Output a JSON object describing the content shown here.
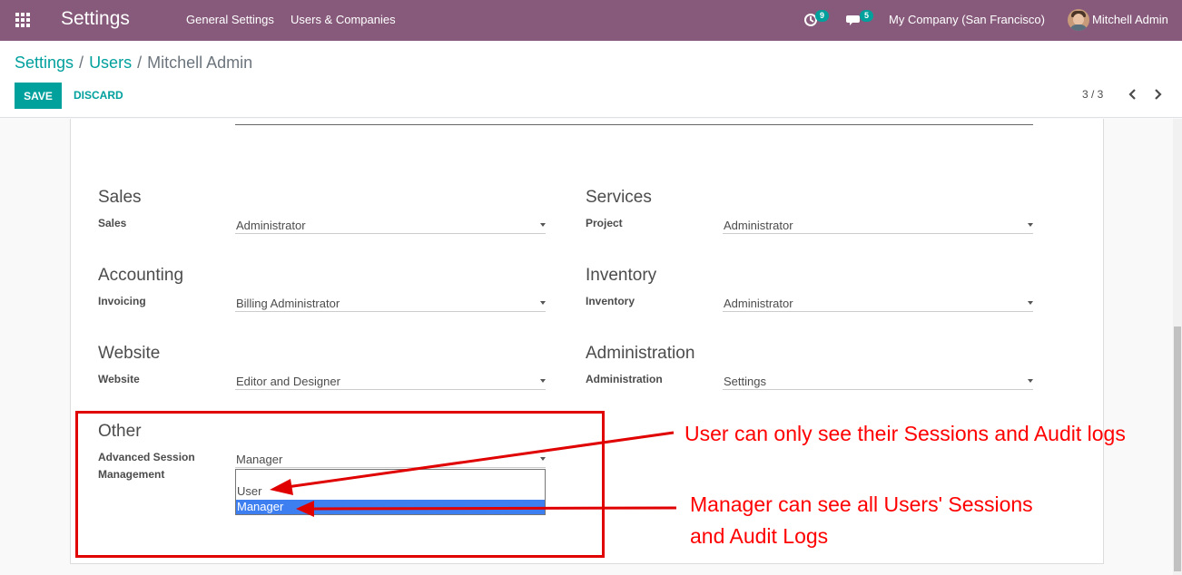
{
  "navbar": {
    "app_name": "Settings",
    "menu": [
      "General Settings",
      "Users & Companies"
    ],
    "activity_count": "9",
    "messages_count": "5",
    "company": "My Company (San Francisco)",
    "user": "Mitchell Admin"
  },
  "breadcrumb": [
    "Settings",
    "Users",
    "Mitchell Admin"
  ],
  "actions": {
    "save": "SAVE",
    "discard": "DISCARD"
  },
  "pager": {
    "value": "3 / 3"
  },
  "groups": [
    {
      "title": "Sales",
      "label": "Sales",
      "value": "Administrator"
    },
    {
      "title": "Services",
      "label": "Project",
      "value": "Administrator"
    },
    {
      "title": "Accounting",
      "label": "Invoicing",
      "value": "Billing Administrator"
    },
    {
      "title": "Inventory",
      "label": "Inventory",
      "value": "Administrator"
    },
    {
      "title": "Website",
      "label": "Website",
      "value": "Editor and Designer"
    },
    {
      "title": "Administration",
      "label": "Administration",
      "value": "Settings"
    },
    {
      "title": "Other",
      "label_line1": "Advanced Session",
      "label_line2": "Management",
      "value": "Manager"
    }
  ],
  "dropdown": {
    "options": [
      "User",
      "Manager"
    ],
    "selected": "Manager"
  },
  "annotations": {
    "user_note": "User can only see their Sessions and Audit logs",
    "manager_note_line1": "Manager can see all Users' Sessions",
    "manager_note_line2": "and Audit Logs",
    "color": "#ff0000"
  },
  "colors": {
    "navbar": "#875a7b",
    "accent": "#00a09d",
    "highlight": "#3d7ff0"
  }
}
